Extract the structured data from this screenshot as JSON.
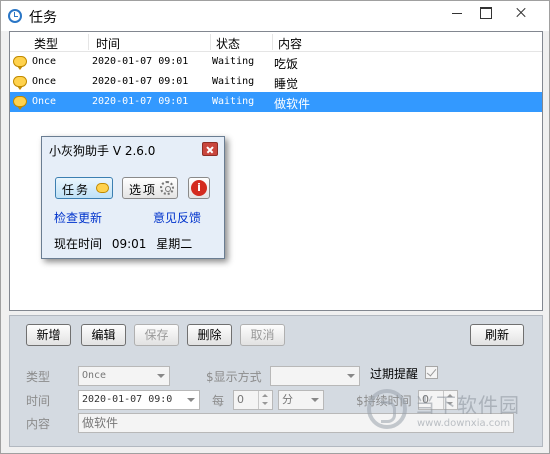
{
  "window": {
    "title": "任务",
    "controls": [
      "minimize",
      "maximize",
      "close"
    ]
  },
  "list": {
    "columns": [
      "类型",
      "时间",
      "状态",
      "内容"
    ],
    "rows": [
      {
        "type": "Once",
        "time": "2020-01-07 09:01",
        "status": "Waiting",
        "content": "吃饭",
        "selected": false
      },
      {
        "type": "Once",
        "time": "2020-01-07 09:01",
        "status": "Waiting",
        "content": "睡觉",
        "selected": false
      },
      {
        "type": "Once",
        "time": "2020-01-07 09:01",
        "status": "Waiting",
        "content": "做软件",
        "selected": true
      }
    ]
  },
  "popup": {
    "title": "小灰狗助手 V 2.6.0",
    "task_button": "任务",
    "options_button": "选项",
    "info_button": "i",
    "check_update": "检查更新",
    "feedback": "意见反馈",
    "current_time_label": "现在时间",
    "current_time": "09:01",
    "weekday": "星期二"
  },
  "toolbar": {
    "add": "新增",
    "edit": "编辑",
    "save": "保存",
    "delete": "删除",
    "cancel": "取消",
    "refresh": "刷新"
  },
  "form": {
    "type_label": "类型",
    "type_value": "Once",
    "display_mode_label": "$显示方式",
    "display_mode_value": "",
    "overdue_label": "过期提醒",
    "overdue_checked": true,
    "time_label": "时间",
    "time_value": "2020-01-07 09:0",
    "every_label": "每",
    "every_value": "0",
    "unit_value": "分",
    "duration_label": "$持续时间",
    "duration_value": "0",
    "content_label": "内容",
    "content_value": "做软件"
  },
  "watermark": {
    "name": "当下软件园",
    "url": "www.downxia.com"
  },
  "colors": {
    "selection": "#3399ff",
    "link": "#0033cc",
    "panel": "#d4dae1"
  }
}
